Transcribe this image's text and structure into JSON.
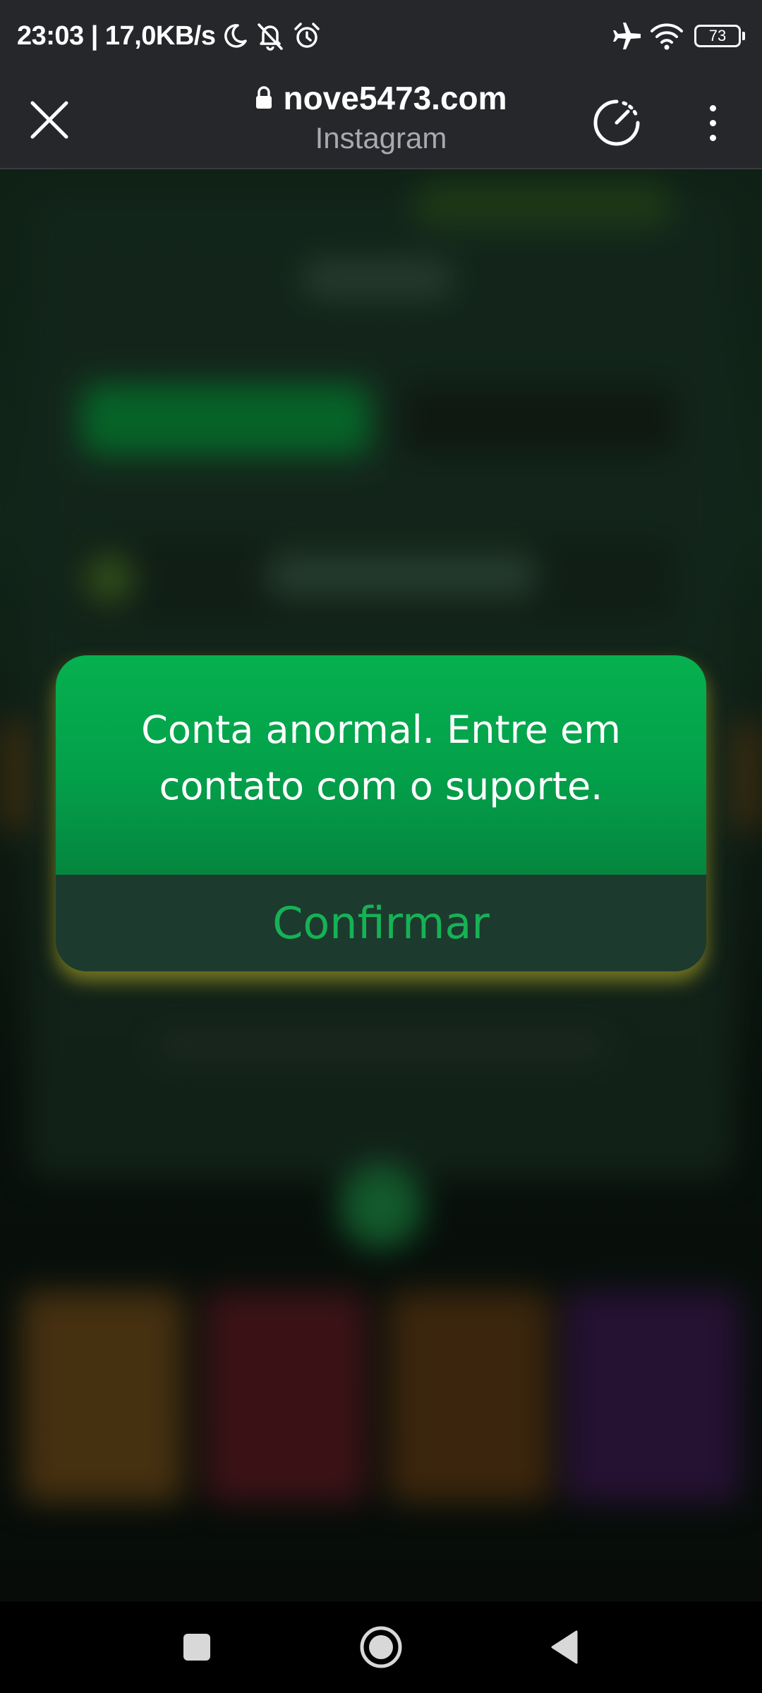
{
  "status_bar": {
    "time_speed": "23:03 | 17,0KB/s",
    "battery_level": "73",
    "icons": [
      "moon-icon",
      "bell-off-icon",
      "alarm-icon",
      "airplane-icon",
      "wifi-icon",
      "battery-icon"
    ]
  },
  "browser": {
    "url": "nove5473.com",
    "source": "Instagram",
    "icons": [
      "close-icon",
      "lock-icon",
      "speedometer-icon",
      "more-vertical-icon"
    ]
  },
  "dialog": {
    "message": "Conta anormal. Entre em contato com o suporte.",
    "confirm_label": "Confirmar",
    "colors": {
      "header": "#03a04a",
      "footer": "#1c3b2e",
      "confirm_text": "#16b256"
    }
  },
  "nav_bar": {
    "icons": [
      "recents-square-icon",
      "home-circle-icon",
      "back-triangle-icon"
    ]
  }
}
